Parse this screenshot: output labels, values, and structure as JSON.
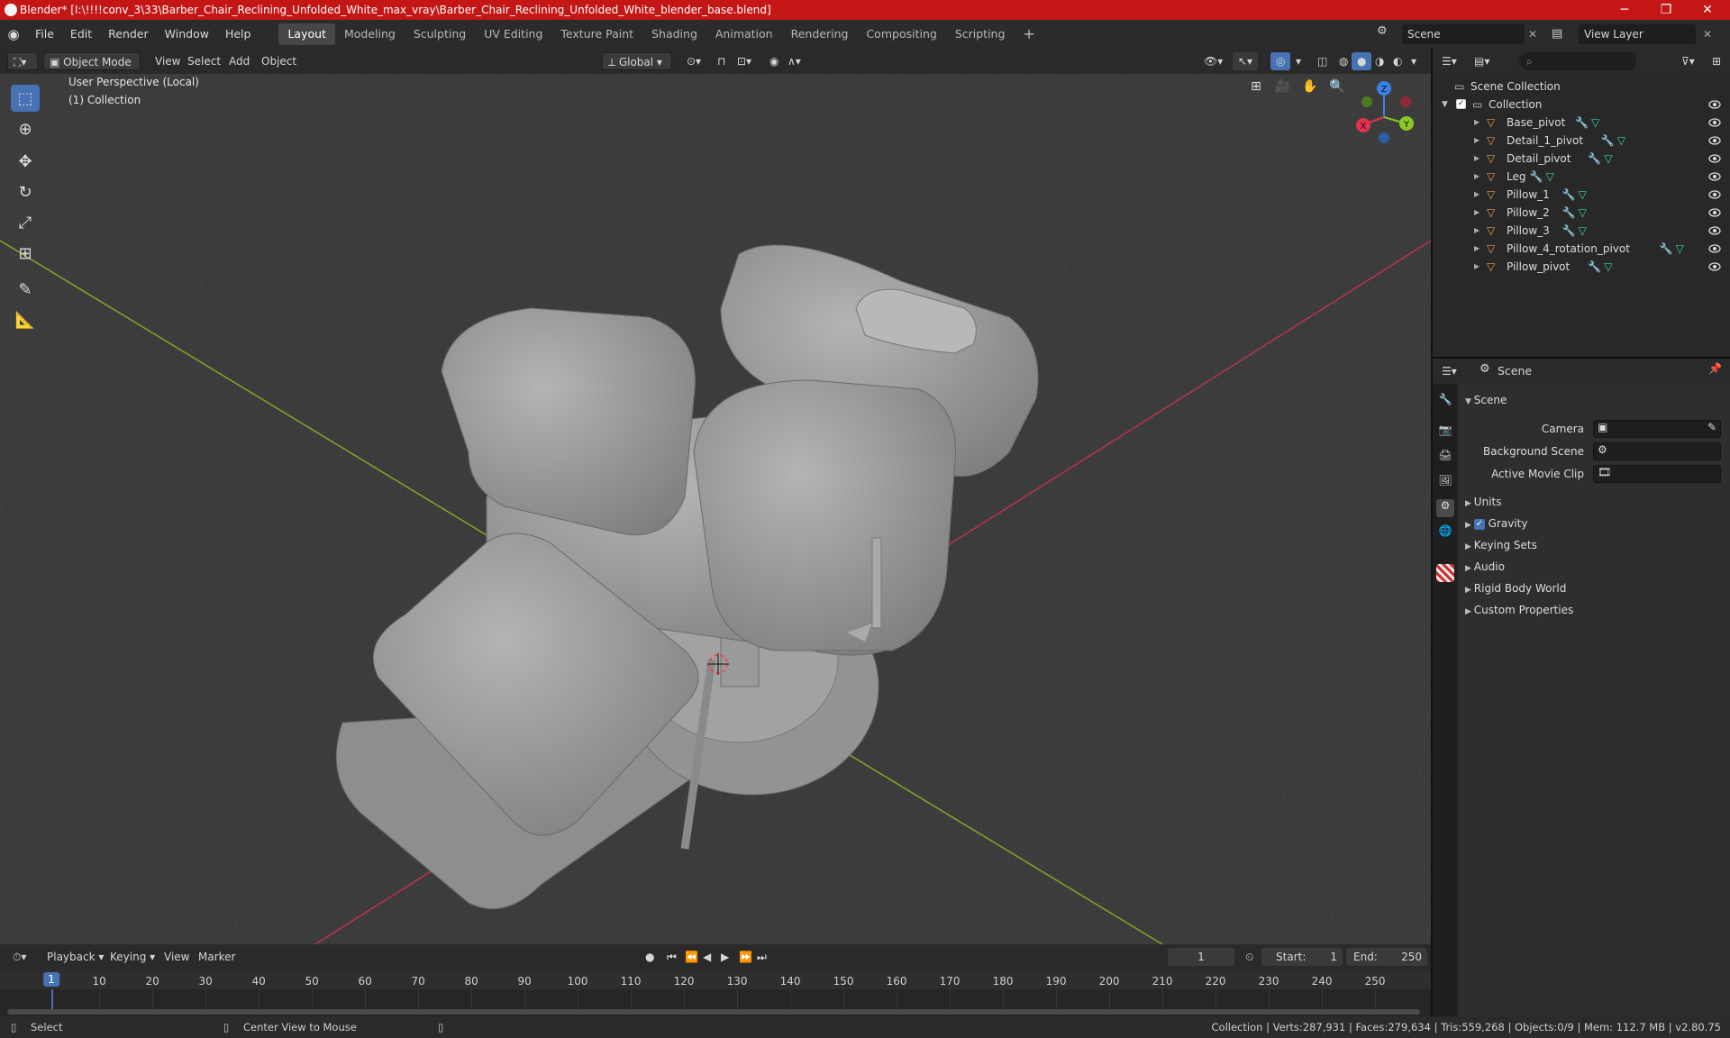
{
  "window": {
    "title": "Blender* [I:\\!!!!conv_3\\33\\Barber_Chair_Reclining_Unfolded_White_max_vray\\Barber_Chair_Reclining_Unfolded_White_blender_base.blend]",
    "minimize": "─",
    "maximize": "❐",
    "close": "✕"
  },
  "menu": [
    "File",
    "Edit",
    "Render",
    "Window",
    "Help"
  ],
  "workspaces": [
    "Layout",
    "Modeling",
    "Sculpting",
    "UV Editing",
    "Texture Paint",
    "Shading",
    "Animation",
    "Rendering",
    "Compositing",
    "Scripting"
  ],
  "workspace_add": "+",
  "scene_selector": {
    "scene": "Scene",
    "view_layer": "View Layer"
  },
  "viewport_header": {
    "mode": "Object Mode",
    "menus": [
      "View",
      "Select",
      "Add",
      "Object"
    ],
    "transform_orientation": "Global"
  },
  "viewport": {
    "perspective_label": "User Perspective (Local)",
    "collection_label": "(1) Collection",
    "gizmo": {
      "x": "X",
      "y": "Y",
      "z": "Z"
    }
  },
  "outliner": {
    "root": "Scene Collection",
    "collection": "Collection",
    "items": [
      "Base_pivot",
      "Detail_1_pivot",
      "Detail_pivot",
      "Leg",
      "Pillow_1",
      "Pillow_2",
      "Pillow_3",
      "Pillow_4_rotation_pivot",
      "Pillow_pivot"
    ]
  },
  "properties": {
    "header": "Scene",
    "panel": "Scene",
    "fields": {
      "camera": "Camera",
      "background_scene": "Background Scene",
      "active_movie_clip": "Active Movie Clip"
    },
    "sections": [
      "Units",
      "Gravity",
      "Keying Sets",
      "Audio",
      "Rigid Body World",
      "Custom Properties"
    ],
    "gravity_checked": true
  },
  "timeline": {
    "menus": [
      "Playback",
      "Keying",
      "View",
      "Marker"
    ],
    "current_frame": "1",
    "start_label": "Start:",
    "start": "1",
    "end_label": "End:",
    "end": "250",
    "ticks": [
      "1",
      "10",
      "20",
      "30",
      "40",
      "50",
      "60",
      "70",
      "80",
      "90",
      "100",
      "110",
      "120",
      "130",
      "140",
      "150",
      "160",
      "170",
      "180",
      "190",
      "200",
      "210",
      "220",
      "230",
      "240",
      "250"
    ]
  },
  "status": {
    "left_action": "Select",
    "middle_action": "Center View to Mouse",
    "stats": "Collection | Verts:287,931 | Faces:279,634 | Tris:559,268 | Objects:0/9 | Mem: 112.7 MB | v2.80.75"
  },
  "colors": {
    "title_bar": "#c51616",
    "accent": "#4772b3",
    "x_axis": "#e3324e",
    "y_axis": "#8bc627",
    "z_axis": "#3a82e8",
    "mesh_icon": "#e8a04a"
  }
}
